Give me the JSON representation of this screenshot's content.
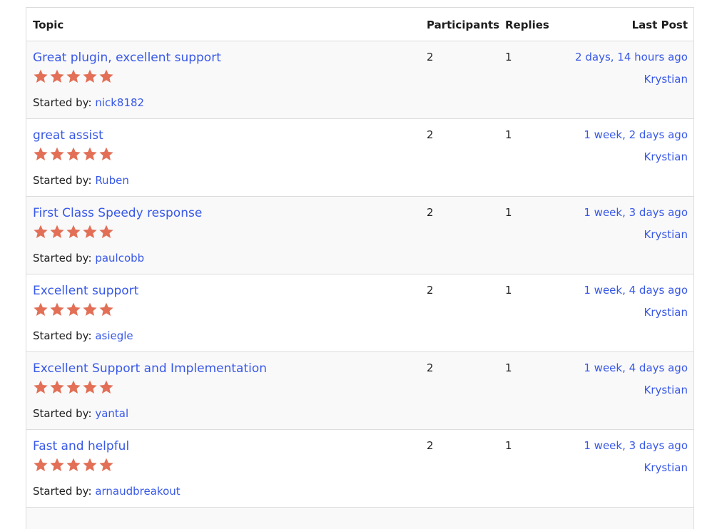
{
  "table": {
    "headers": {
      "topic": "Topic",
      "participants": "Participants",
      "replies": "Replies",
      "last_post": "Last Post"
    },
    "started_by_label": "Started by:",
    "star_color": "#e26f56",
    "link_color": "#3858e9",
    "rows": [
      {
        "title": "Great plugin, excellent support",
        "rating": 5,
        "author": "nick8182",
        "participants": "2",
        "replies": "1",
        "last_time": "2 days, 14 hours ago",
        "last_author": "Krystian"
      },
      {
        "title": "great assist",
        "rating": 5,
        "author": "Ruben",
        "participants": "2",
        "replies": "1",
        "last_time": "1 week, 2 days ago",
        "last_author": "Krystian"
      },
      {
        "title": "First Class Speedy response",
        "rating": 5,
        "author": "paulcobb",
        "participants": "2",
        "replies": "1",
        "last_time": "1 week, 3 days ago",
        "last_author": "Krystian"
      },
      {
        "title": "Excellent support",
        "rating": 5,
        "author": "asiegle",
        "participants": "2",
        "replies": "1",
        "last_time": "1 week, 4 days ago",
        "last_author": "Krystian"
      },
      {
        "title": "Excellent Support and Implementation",
        "rating": 5,
        "author": "yantal",
        "participants": "2",
        "replies": "1",
        "last_time": "1 week, 4 days ago",
        "last_author": "Krystian"
      },
      {
        "title": "Fast and helpful",
        "rating": 5,
        "author": "arnaudbreakout",
        "participants": "2",
        "replies": "1",
        "last_time": "1 week, 3 days ago",
        "last_author": "Krystian"
      }
    ]
  }
}
